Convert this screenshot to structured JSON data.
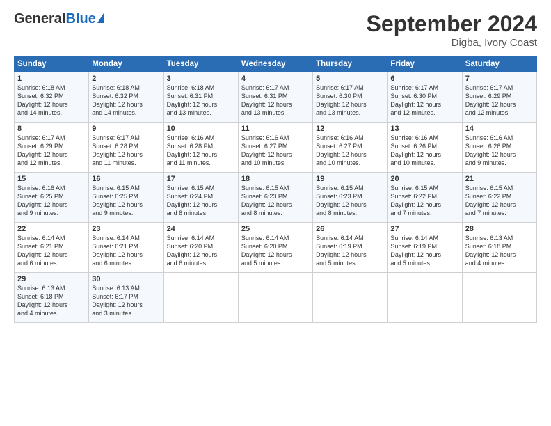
{
  "logo": {
    "general": "General",
    "blue": "Blue"
  },
  "title": "September 2024",
  "location": "Digba, Ivory Coast",
  "days_header": [
    "Sunday",
    "Monday",
    "Tuesday",
    "Wednesday",
    "Thursday",
    "Friday",
    "Saturday"
  ],
  "weeks": [
    [
      {
        "day": "1",
        "sunrise": "6:18 AM",
        "sunset": "6:32 PM",
        "daylight": "12 hours and 14 minutes."
      },
      {
        "day": "2",
        "sunrise": "6:18 AM",
        "sunset": "6:32 PM",
        "daylight": "12 hours and 14 minutes."
      },
      {
        "day": "3",
        "sunrise": "6:18 AM",
        "sunset": "6:31 PM",
        "daylight": "12 hours and 13 minutes."
      },
      {
        "day": "4",
        "sunrise": "6:17 AM",
        "sunset": "6:31 PM",
        "daylight": "12 hours and 13 minutes."
      },
      {
        "day": "5",
        "sunrise": "6:17 AM",
        "sunset": "6:30 PM",
        "daylight": "12 hours and 13 minutes."
      },
      {
        "day": "6",
        "sunrise": "6:17 AM",
        "sunset": "6:30 PM",
        "daylight": "12 hours and 12 minutes."
      },
      {
        "day": "7",
        "sunrise": "6:17 AM",
        "sunset": "6:29 PM",
        "daylight": "12 hours and 12 minutes."
      }
    ],
    [
      {
        "day": "8",
        "sunrise": "6:17 AM",
        "sunset": "6:29 PM",
        "daylight": "12 hours and 12 minutes."
      },
      {
        "day": "9",
        "sunrise": "6:17 AM",
        "sunset": "6:28 PM",
        "daylight": "12 hours and 11 minutes."
      },
      {
        "day": "10",
        "sunrise": "6:16 AM",
        "sunset": "6:28 PM",
        "daylight": "12 hours and 11 minutes."
      },
      {
        "day": "11",
        "sunrise": "6:16 AM",
        "sunset": "6:27 PM",
        "daylight": "12 hours and 10 minutes."
      },
      {
        "day": "12",
        "sunrise": "6:16 AM",
        "sunset": "6:27 PM",
        "daylight": "12 hours and 10 minutes."
      },
      {
        "day": "13",
        "sunrise": "6:16 AM",
        "sunset": "6:26 PM",
        "daylight": "12 hours and 10 minutes."
      },
      {
        "day": "14",
        "sunrise": "6:16 AM",
        "sunset": "6:26 PM",
        "daylight": "12 hours and 9 minutes."
      }
    ],
    [
      {
        "day": "15",
        "sunrise": "6:16 AM",
        "sunset": "6:25 PM",
        "daylight": "12 hours and 9 minutes."
      },
      {
        "day": "16",
        "sunrise": "6:15 AM",
        "sunset": "6:25 PM",
        "daylight": "12 hours and 9 minutes."
      },
      {
        "day": "17",
        "sunrise": "6:15 AM",
        "sunset": "6:24 PM",
        "daylight": "12 hours and 8 minutes."
      },
      {
        "day": "18",
        "sunrise": "6:15 AM",
        "sunset": "6:23 PM",
        "daylight": "12 hours and 8 minutes."
      },
      {
        "day": "19",
        "sunrise": "6:15 AM",
        "sunset": "6:23 PM",
        "daylight": "12 hours and 8 minutes."
      },
      {
        "day": "20",
        "sunrise": "6:15 AM",
        "sunset": "6:22 PM",
        "daylight": "12 hours and 7 minutes."
      },
      {
        "day": "21",
        "sunrise": "6:15 AM",
        "sunset": "6:22 PM",
        "daylight": "12 hours and 7 minutes."
      }
    ],
    [
      {
        "day": "22",
        "sunrise": "6:14 AM",
        "sunset": "6:21 PM",
        "daylight": "12 hours and 6 minutes."
      },
      {
        "day": "23",
        "sunrise": "6:14 AM",
        "sunset": "6:21 PM",
        "daylight": "12 hours and 6 minutes."
      },
      {
        "day": "24",
        "sunrise": "6:14 AM",
        "sunset": "6:20 PM",
        "daylight": "12 hours and 6 minutes."
      },
      {
        "day": "25",
        "sunrise": "6:14 AM",
        "sunset": "6:20 PM",
        "daylight": "12 hours and 5 minutes."
      },
      {
        "day": "26",
        "sunrise": "6:14 AM",
        "sunset": "6:19 PM",
        "daylight": "12 hours and 5 minutes."
      },
      {
        "day": "27",
        "sunrise": "6:14 AM",
        "sunset": "6:19 PM",
        "daylight": "12 hours and 5 minutes."
      },
      {
        "day": "28",
        "sunrise": "6:13 AM",
        "sunset": "6:18 PM",
        "daylight": "12 hours and 4 minutes."
      }
    ],
    [
      {
        "day": "29",
        "sunrise": "6:13 AM",
        "sunset": "6:18 PM",
        "daylight": "12 hours and 4 minutes."
      },
      {
        "day": "30",
        "sunrise": "6:13 AM",
        "sunset": "6:17 PM",
        "daylight": "12 hours and 3 minutes."
      },
      null,
      null,
      null,
      null,
      null
    ]
  ],
  "labels": {
    "sunrise": "Sunrise: ",
    "sunset": "Sunset: ",
    "daylight": "Daylight: "
  }
}
